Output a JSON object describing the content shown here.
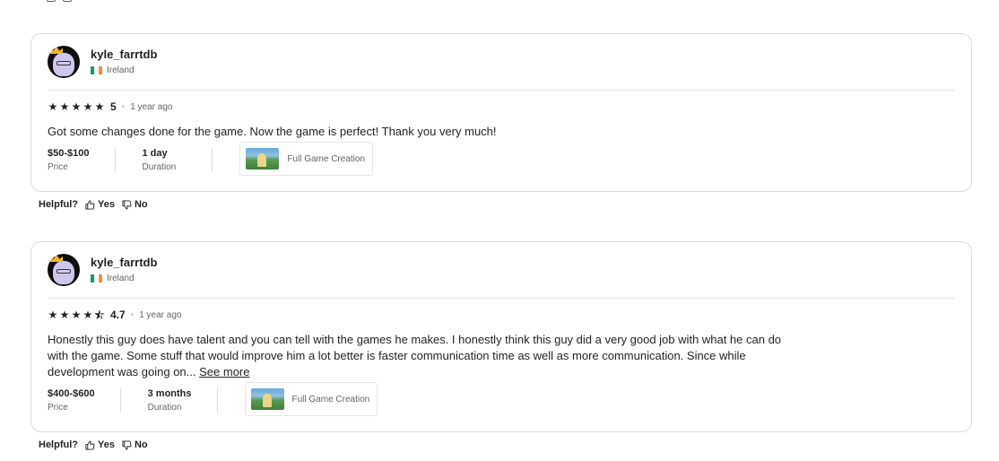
{
  "reviews": [
    {
      "username": "kyle_farrtdb",
      "country": "Ireland",
      "rating": "5",
      "stars_filled": 5,
      "time_ago": "1 year ago",
      "text": "Got some changes done for the game. Now the game is perfect! Thank you very much!",
      "see_more": "",
      "price_value": "$50-$100",
      "price_label": "Price",
      "duration_value": "1 day",
      "duration_label": "Duration",
      "gig_title": "Full Game Creation"
    },
    {
      "username": "kyle_farrtdb",
      "country": "Ireland",
      "rating": "4.7",
      "stars_filled": 4.7,
      "time_ago": "1 year ago",
      "text": "Honestly this guy does have talent and you can tell with the games he makes. I honestly think this guy did a very good job with what he can do with the game. Some stuff that would improve him a lot better is faster communication time as well as more communication. Since while development was going on...",
      "see_more": "See more",
      "price_value": "$400-$600",
      "price_label": "Price",
      "duration_value": "3 months",
      "duration_label": "Duration",
      "gig_title": "Full Game Creation"
    }
  ],
  "helpful": {
    "label": "Helpful?",
    "yes": "Yes",
    "no": "No"
  },
  "colors": {
    "text": "#222325",
    "muted": "#62646a",
    "border": "#dadbdd",
    "flag_green": "#169b62",
    "flag_white": "#ffffff",
    "flag_orange": "#ff883e"
  }
}
